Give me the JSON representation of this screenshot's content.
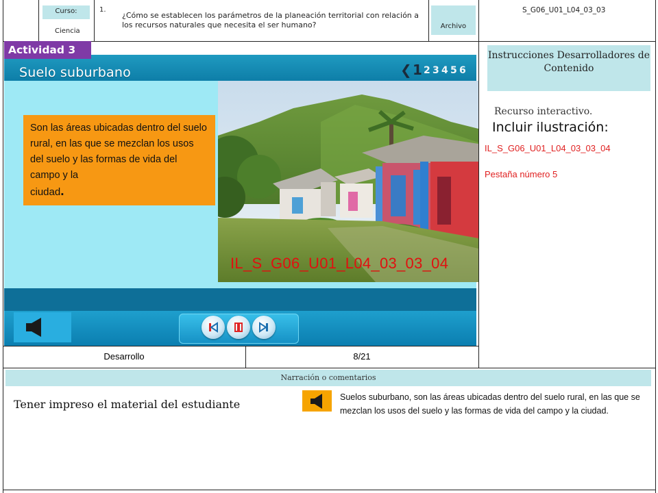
{
  "header": {
    "curso_label": "Curso:",
    "subject": "Ciencia",
    "question_number": "1.",
    "question_text": "¿Cómo se establecen los parámetros de la planeación territorial con relación a los recursos naturales que necesita el ser humano?",
    "archivo_label": "Archivo",
    "file_code": "S_G06_U01_L04_03_03"
  },
  "slide": {
    "activity_label": "Actividad 3",
    "title": "Suelo suburbano",
    "current_page": "1",
    "pages": [
      "2",
      "3",
      "4",
      "5",
      "6"
    ],
    "definition_main": "Son las áreas ubicadas dentro del suelo rural, en las que se mezclan los usos del suelo y las formas de vida del campo y la",
    "definition_last": "ciudad",
    "definition_period": ".",
    "image_label": "IL_S_G06_U01_L04_03_03_04"
  },
  "footer_row": {
    "section": "Desarrollo",
    "page_count": "8/21"
  },
  "right_panel": {
    "instructions_title": "Instrucciones Desarrolladores de Contenido",
    "resource_text": "Recurso interactivo.",
    "include_text": "Incluir ilustración:",
    "illustration_code": "IL_S_G06_U01_L04_03_03_04",
    "tab_note": "Pestaña número 5"
  },
  "narration": {
    "strip_label": "Narración o comentarios",
    "student_note": "Tener impreso el material del estudiante",
    "text": "Suelos suburbano, son las áreas ubicadas dentro del suelo rural, en las que se mezclan los usos del suelo y las formas de vida del campo y la ciudad."
  },
  "colors": {
    "activity_purple": "#7f3aa6",
    "slide_blue": "#0e7ea8",
    "content_cyan": "#9ee9f5",
    "definition_orange": "#f79813",
    "label_red": "#e01010",
    "panel_cyan": "#bfe6ea"
  },
  "icons": [
    "speaker-icon",
    "previous-icon",
    "pause-icon",
    "next-icon",
    "page-back-arrow-icon"
  ]
}
